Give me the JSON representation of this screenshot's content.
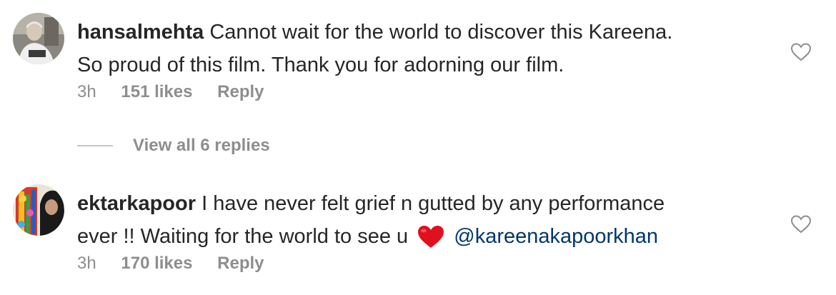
{
  "comments": [
    {
      "username": "hansalmehta",
      "text_line1": "Cannot wait for the world to discover this Kareena.",
      "text_line2": "So proud of this film. Thank you for adorning our film.",
      "time": "3h",
      "likes": "151 likes",
      "reply_label": "Reply",
      "view_replies": "View all 6 replies",
      "avatar_icon": "user-avatar-photo",
      "like_icon": "heart-outline-icon"
    },
    {
      "username": "ektarkapoor",
      "text_line1": "I have never felt grief n gutted by any performance",
      "text_line2_prefix": "ever !! Waiting for the world to see u",
      "emoji": "red-heart-emoji",
      "mention": "@kareenakapoorkhan",
      "time": "3h",
      "likes": "170 likes",
      "reply_label": "Reply",
      "avatar_icon": "user-avatar-photo",
      "like_icon": "heart-outline-icon"
    }
  ],
  "colors": {
    "text": "#262626",
    "secondary": "#8e8e8e",
    "mention": "#00376b",
    "emoji_heart": "#e0101f"
  }
}
